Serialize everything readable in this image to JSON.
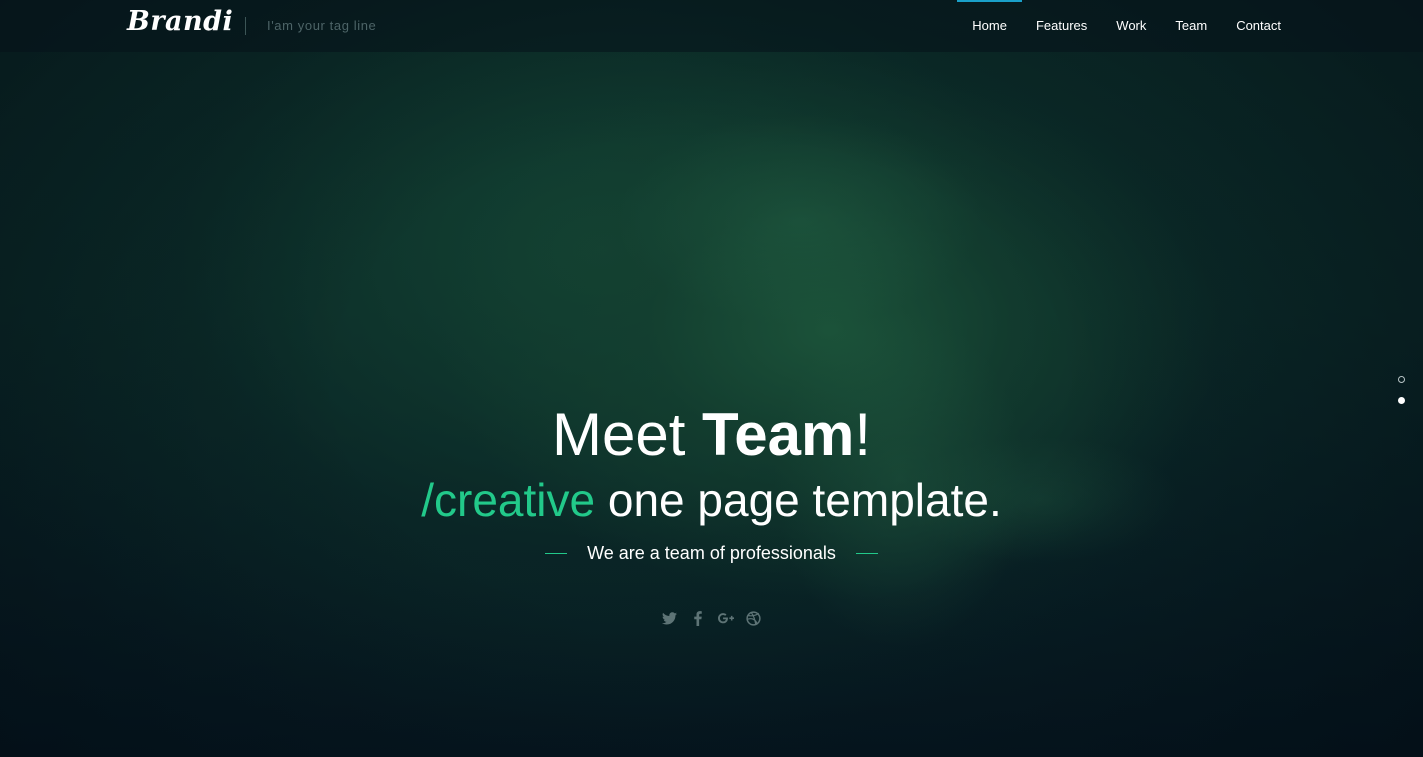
{
  "header": {
    "brand": "Brandi",
    "tagline": "I'am your tag line",
    "nav": [
      {
        "label": "Home",
        "active": true
      },
      {
        "label": "Features",
        "active": false
      },
      {
        "label": "Work",
        "active": false
      },
      {
        "label": "Team",
        "active": false
      },
      {
        "label": "Contact",
        "active": false
      }
    ]
  },
  "hero": {
    "headline_prefix": "Meet ",
    "headline_strong": "Team",
    "headline_suffix": "!",
    "subline_accent": "/creative",
    "subline_rest": " one page template.",
    "tagline": "We are a team of professionals",
    "social_icons": [
      "twitter-icon",
      "facebook-icon",
      "google-plus-icon",
      "dribbble-icon"
    ]
  },
  "slider": {
    "slides": 2,
    "active_slide": 2
  },
  "colors": {
    "accent": "#22c98a",
    "nav_active": "#1aa0c9"
  }
}
